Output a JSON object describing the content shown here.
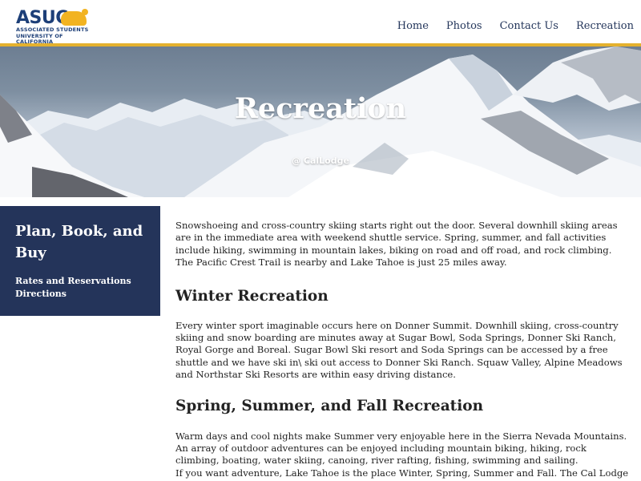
{
  "header": {
    "logo": {
      "word": "ASUC",
      "subtitle": "ASSOCIATED STUDENTS UNIVERSITY OF CALIFORNIA",
      "brand_colors": {
        "blue": "#1d3f78",
        "gold": "#f2b321"
      },
      "icon": "bear-icon"
    },
    "nav": [
      {
        "label": "Home"
      },
      {
        "label": "Photos"
      },
      {
        "label": "Contact Us"
      },
      {
        "label": "Recreation"
      }
    ],
    "accent_bar_color": "#e4b12e"
  },
  "hero": {
    "title": "Recreation",
    "subtitle": "@ CalLodge"
  },
  "sidebar": {
    "title": "Plan, Book, and Buy",
    "links": [
      {
        "label": "Rates and Reservations"
      },
      {
        "label": "Directions"
      }
    ],
    "background": "#24345a"
  },
  "main": {
    "intro": "Snowshoeing and cross-country skiing starts right out the door. Several downhill skiing areas are in the immediate area with weekend shuttle service. Spring, summer, and fall activities include hiking, swimming in mountain lakes, biking on road and off road, and rock climbing. The Pacific Crest Trail is nearby and Lake Tahoe is just 25 miles away.",
    "sections": [
      {
        "heading": "Winter Recreation",
        "body": "Every winter sport imaginable occurs here on Donner Summit. Downhill skiing, cross-country skiing and snow boarding are minutes away at Sugar Bowl, Soda Springs, Donner Ski Ranch, Royal Gorge and Boreal. Sugar Bowl Ski resort and Soda Springs can be accessed by a free shuttle and we have ski in\\ ski out access to Donner Ski Ranch. Squaw Valley, Alpine Meadows and Northstar Ski Resorts are within easy driving distance."
      },
      {
        "heading": "Spring, Summer, and Fall Recreation",
        "body": "Warm days and cool nights make Summer very enjoyable here in the Sierra Nevada Mountains. An array of outdoor adventures can be enjoyed including mountain biking, hiking, rock climbing, boating, water skiing, canoing, river rafting, fishing, swimming and sailing.",
        "body2": "If you want adventure, Lake Tahoe is the place Winter, Spring, Summer and Fall. The Cal Lodge"
      }
    ]
  }
}
